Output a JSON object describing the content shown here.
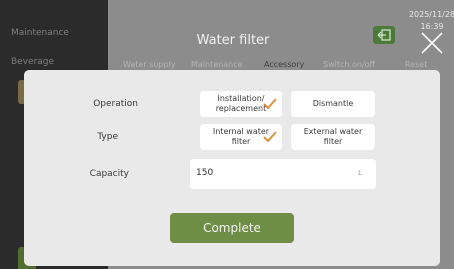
{
  "sidebar": {
    "items": [
      {
        "label": "Maintenance"
      },
      {
        "label": "Beverage"
      }
    ]
  },
  "header": {
    "title": "Water filter",
    "datetime_line1": "2025/11/28",
    "datetime_line2": "16:39"
  },
  "tabs": [
    {
      "label": "Water supply"
    },
    {
      "label": "Maintenance"
    },
    {
      "label": "Accessory"
    },
    {
      "label": "Switch on/off"
    },
    {
      "label": "Reset"
    }
  ],
  "dialog": {
    "operation": {
      "label": "Operation",
      "options": [
        {
          "label": "Installation/ replacement",
          "selected": true
        },
        {
          "label": "Dismantle",
          "selected": false
        }
      ]
    },
    "type": {
      "label": "Type",
      "options": [
        {
          "label": "Internal water filter",
          "selected": true
        },
        {
          "label": "External water filter",
          "selected": false
        }
      ]
    },
    "capacity": {
      "label": "Capacity",
      "value": "150",
      "unit": "L"
    },
    "complete_label": "Complete"
  },
  "colors": {
    "accent_green": "#6f8e45",
    "check_orange": "#d9923a"
  }
}
